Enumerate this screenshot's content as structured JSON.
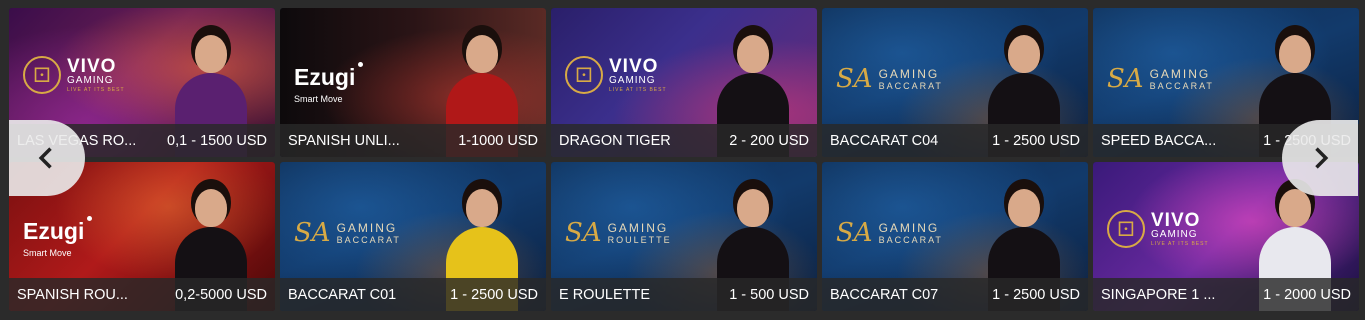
{
  "carousel": {
    "prev_icon": "chevron-left-icon",
    "next_icon": "chevron-right-icon"
  },
  "tiles": [
    {
      "name": "LAS VEGAS RO...",
      "limits": "0,1 - 1500 USD",
      "provider": "vivo",
      "theme": "vivo-purple"
    },
    {
      "name": "SPANISH UNLI...",
      "limits": "1-1000 USD",
      "provider": "ezugi",
      "theme": "ezugi-dark"
    },
    {
      "name": "DRAGON TIGER",
      "limits": "2 - 200 USD",
      "provider": "vivo",
      "theme": "vivo-blue"
    },
    {
      "name": "BACCARAT C04",
      "limits": "1 - 2500 USD",
      "provider": "sa-baccarat",
      "theme": "sa"
    },
    {
      "name": "SPEED BACCA...",
      "limits": "1 - 2500 USD",
      "provider": "sa-baccarat",
      "theme": "sa"
    },
    {
      "name": "SPANISH ROU...",
      "limits": "0,2-5000 USD",
      "provider": "ezugi",
      "theme": "ezugi-red"
    },
    {
      "name": "BACCARAT C01",
      "limits": "1 - 2500 USD",
      "provider": "sa-baccarat",
      "theme": "sa"
    },
    {
      "name": "E ROULETTE",
      "limits": "1 - 500 USD",
      "provider": "sa-roulette",
      "theme": "sa"
    },
    {
      "name": "BACCARAT C07",
      "limits": "1 - 2500 USD",
      "provider": "sa-baccarat",
      "theme": "sa"
    },
    {
      "name": "SINGAPORE 1 ...",
      "limits": "1 - 2000 USD",
      "provider": "vivo",
      "theme": "vivo-night"
    }
  ],
  "logos": {
    "vivo": {
      "brand": "VIVO",
      "sub": "GAMING",
      "tag": "LIVE AT ITS BEST"
    },
    "ezugi": {
      "brand": "Ezugi",
      "sub": "Smart Move"
    },
    "sa_baccarat": {
      "mark": "SA",
      "brand": "GAMING",
      "sub": "BACCARAT"
    },
    "sa_roulette": {
      "mark": "SA",
      "brand": "GAMING",
      "sub": "ROULETTE"
    }
  }
}
